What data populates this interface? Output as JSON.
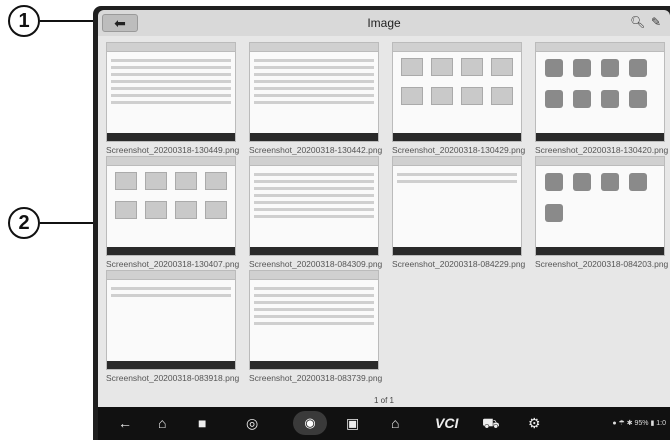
{
  "callouts": {
    "one": "1",
    "two": "2"
  },
  "titlebar": {
    "title": "Image",
    "back_icon": "back-arrow-icon",
    "search_icon": "search-icon",
    "edit_icon": "pencil-icon"
  },
  "thumbnails": [
    {
      "filename": "Screenshot_20200318-130449.png"
    },
    {
      "filename": "Screenshot_20200318-130442.png"
    },
    {
      "filename": "Screenshot_20200318-130429.png"
    },
    {
      "filename": "Screenshot_20200318-130420.png"
    },
    {
      "filename": "Screenshot_20200318-130407.png"
    },
    {
      "filename": "Screenshot_20200318-084309.png"
    },
    {
      "filename": "Screenshot_20200318-084229.png"
    },
    {
      "filename": "Screenshot_20200318-084203.png"
    },
    {
      "filename": "Screenshot_20200318-083918.png"
    },
    {
      "filename": "Screenshot_20200318-083739.png"
    }
  ],
  "pagination": "1 of 1",
  "navbar": {
    "icons": [
      "back-icon",
      "home-icon",
      "recent-apps-icon",
      "browser-icon",
      "camera-icon",
      "screen-record-icon",
      "garage-icon",
      "vci-icon",
      "car-icon",
      "vehicle-service-icon"
    ],
    "vci_label": "VCI",
    "status": "● ☂ ✱ 95% ▮ 1:0"
  }
}
